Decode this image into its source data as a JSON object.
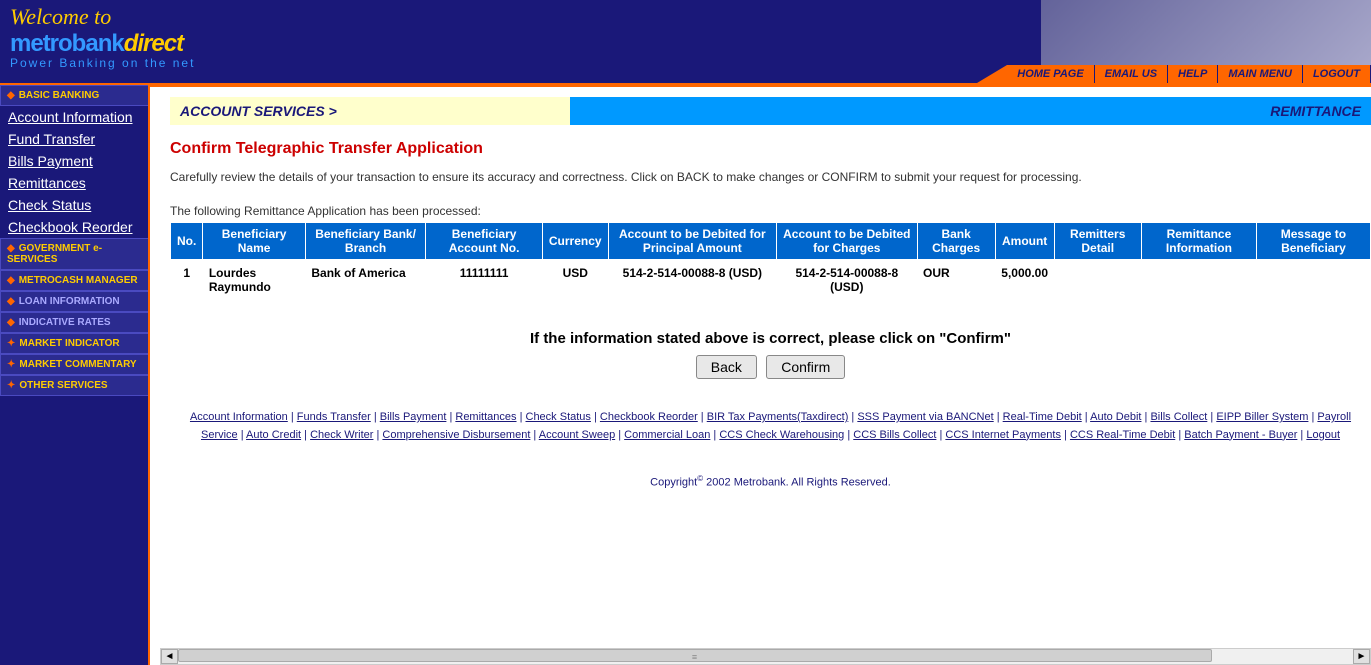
{
  "header": {
    "welcome": "Welcome to",
    "logo_main": "metrobank",
    "logo_suffix": "direct",
    "tagline": "Power Banking on the net",
    "nav": {
      "home": "HOME PAGE",
      "email": "EMAIL US",
      "help": "HELP",
      "menu": "MAIN MENU",
      "logout": "LOGOUT"
    }
  },
  "sidebar": {
    "sections": {
      "basic": "BASIC BANKING",
      "gov": "GOVERNMENT e-SERVICES",
      "metrocash": "METROCASH MANAGER",
      "loan": "LOAN INFORMATION",
      "rates": "INDICATIVE RATES",
      "market_ind": "MARKET INDICATOR",
      "market_com": "MARKET COMMENTARY",
      "other": "OTHER SERVICES"
    },
    "basic_links": {
      "account_info": "Account Information",
      "fund_transfer": "Fund Transfer",
      "bills": "Bills Payment",
      "remit": "Remittances",
      "check": "Check Status",
      "checkbook": "Checkbook Reorder"
    }
  },
  "main": {
    "breadcrumb": "ACCOUNT SERVICES >",
    "section": "REMITTANCE",
    "subtitle": "Confirm Telegraphic Transfer Application",
    "instruction": "Carefully review the details of your transaction to ensure its accuracy and correctness. Click on BACK to make changes or CONFIRM to submit your request for processing.",
    "processed_note": "The following Remittance Application has been processed:",
    "table": {
      "headers": {
        "no": "No.",
        "benef_name": "Beneficiary Name",
        "benef_bank": "Beneficiary Bank/ Branch",
        "benef_acct": "Beneficiary Account No.",
        "currency": "Currency",
        "debit_principal": "Account to be Debited for Principal Amount",
        "debit_charges": "Account to be Debited for Charges",
        "bank_charges": "Bank Charges",
        "amount": "Amount",
        "remitters": "Remitters Detail",
        "remit_info": "Remittance Information",
        "msg_benef": "Message to Beneficiary"
      },
      "row": {
        "no": "1",
        "benef_name": "Lourdes Raymundo",
        "benef_bank": "Bank of America",
        "benef_acct": "11111111",
        "currency": "USD",
        "debit_principal": "514-2-514-00088-8 (USD)",
        "debit_charges": "514-2-514-00088-8 (USD)",
        "bank_charges": "OUR",
        "amount": "5,000.00",
        "remitters": "",
        "remit_info": "",
        "msg_benef": ""
      }
    },
    "confirm_line": "If the information stated above is correct, please click on \"Confirm\"",
    "buttons": {
      "back": "Back",
      "confirm": "Confirm"
    }
  },
  "footer": {
    "links": {
      "l1": "Account Information",
      "l2": "Funds Transfer",
      "l3": "Bills Payment",
      "l4": "Remittances",
      "l5": "Check Status",
      "l6": "Checkbook Reorder",
      "l7": "BIR Tax Payments(Taxdirect)",
      "l8": "SSS Payment via BANCNet",
      "l9": "Real-Time Debit",
      "l10": "Auto Debit",
      "l11": "Bills Collect",
      "l12": "EIPP Biller System",
      "l13": "Payroll Service",
      "l14": "Auto Credit",
      "l15": "Check Writer",
      "l16": "Comprehensive Disbursement",
      "l17": "Account Sweep",
      "l18": "Commercial Loan",
      "l19": "CCS Check Warehousing",
      "l20": "CCS Bills Collect",
      "l21": "CCS Internet Payments",
      "l22": "CCS Real-Time Debit",
      "l23": "Batch Payment - Buyer",
      "l24": "Logout"
    },
    "copyright_pre": "Copyright",
    "copyright_post": " 2002 Metrobank. All Rights Reserved."
  }
}
